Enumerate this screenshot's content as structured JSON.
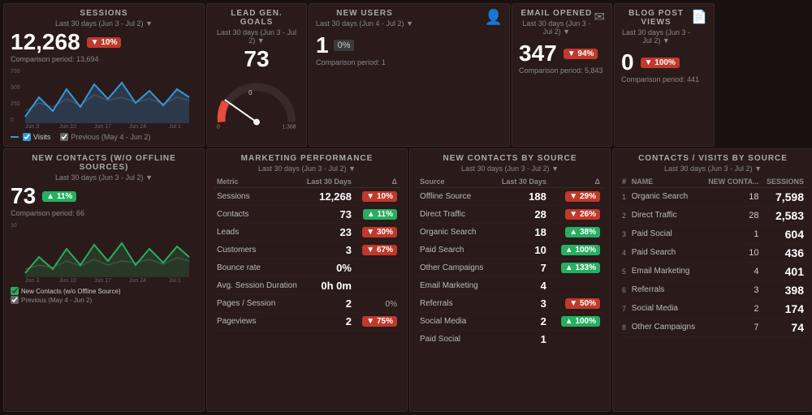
{
  "colors": {
    "red_badge": "#c0392b",
    "green_badge": "#27ae60",
    "bg_panel": "#2a1a1a",
    "blue_line": "#3498db",
    "gray_line": "#7f8c8d",
    "accent_red": "#e74c3c"
  },
  "sessions": {
    "title": "SESSIONS",
    "subtitle": "Last 30 days (Jun 3 - Jul 2)",
    "value": "12,268",
    "badge": "▼ 10%",
    "badge_type": "red",
    "comparison": "Comparison period: 13,694",
    "x_labels": [
      "Jun 3",
      "Jun 10",
      "Jun 17",
      "Jun 24",
      "Jul 1"
    ],
    "y_labels": [
      "750",
      "500",
      "250",
      "0"
    ],
    "legend_visits": "Visits",
    "legend_previous": "Previous (May 4 - Jun 2)"
  },
  "new_contacts": {
    "title": "NEW CONTACTS (W/O OFFLINE SOURCES)",
    "subtitle": "Last 30 days (Jun 3 - Jul 2)",
    "value": "73",
    "badge": "▲ 11%",
    "badge_type": "green",
    "comparison": "Comparison period: 66",
    "legend_contacts": "New Contacts (w/o Offline Source)",
    "legend_previous": "Previous (May 4 - Jun 2)"
  },
  "lead_gen": {
    "title": "LEAD GEN. GOALS",
    "subtitle": "Last 30 days (Jun 3 - Jul 2)",
    "value": "73",
    "gauge_max": "1,368",
    "gauge_min": "0",
    "gauge_label": "0"
  },
  "new_users": {
    "title": "NEW USERS",
    "subtitle": "Last 30 days (Jun 4 - Jul 2)",
    "icon": "person",
    "value": "1",
    "badge": "0%",
    "badge_type": "neutral",
    "comparison": "Comparison period: 1"
  },
  "email_opened": {
    "title": "EMAIL OPENED",
    "subtitle": "Last 30 days (Jun 3 - Jul 2)",
    "icon": "email",
    "value": "347",
    "badge": "▼ 94%",
    "badge_type": "red",
    "comparison": "Comparison period: 5,843"
  },
  "blog_post_views": {
    "title": "BLOG POST VIEWS",
    "subtitle": "Last 30 days (Jun 3 - Jul 2)",
    "icon": "blog",
    "value": "0",
    "badge": "▼ 100%",
    "badge_type": "red",
    "comparison": "Comparison period: 441"
  },
  "marketing_performance": {
    "title": "MARKETING PERFORMANCE",
    "subtitle": "Last 30 days (Jun 3 - Jul 2)",
    "columns": [
      "Metric",
      "Last 30 Days",
      "Δ"
    ],
    "rows": [
      {
        "metric": "Sessions",
        "value": "12,268",
        "badge": "▼ 10%",
        "badge_type": "red"
      },
      {
        "metric": "Contacts",
        "value": "73",
        "badge": "▲ 11%",
        "badge_type": "green"
      },
      {
        "metric": "Leads",
        "value": "23",
        "badge": "▼ 30%",
        "badge_type": "red"
      },
      {
        "metric": "Customers",
        "value": "3",
        "badge": "▼ 67%",
        "badge_type": "red"
      },
      {
        "metric": "Bounce rate",
        "value": "0%",
        "badge": "",
        "badge_type": "none"
      },
      {
        "metric": "Avg. Session Duration",
        "value": "0h 0m",
        "badge": "",
        "badge_type": "none"
      },
      {
        "metric": "Pages / Session",
        "value": "2",
        "badge": "0%",
        "badge_type": "neutral"
      },
      {
        "metric": "Pageviews",
        "value": "2",
        "badge": "▼ 75%",
        "badge_type": "red"
      }
    ]
  },
  "new_contacts_by_source": {
    "title": "NEW CONTACTS BY SOURCE",
    "subtitle": "Last 30 days (Jun 3 - Jul 2)",
    "columns": [
      "Source",
      "Last 30 Days",
      "Δ"
    ],
    "rows": [
      {
        "source": "Offline Source",
        "value": "188",
        "badge": "▼ 29%",
        "badge_type": "red"
      },
      {
        "source": "Direct Traffic",
        "value": "28",
        "badge": "▼ 26%",
        "badge_type": "red"
      },
      {
        "source": "Organic Search",
        "value": "18",
        "badge": "▲ 38%",
        "badge_type": "green"
      },
      {
        "source": "Paid Search",
        "value": "10",
        "badge": "▲ 100%",
        "badge_type": "green"
      },
      {
        "source": "Other Campaigns",
        "value": "7",
        "badge": "▲ 133%",
        "badge_type": "green"
      },
      {
        "source": "Email Marketing",
        "value": "4",
        "badge": "",
        "badge_type": "none"
      },
      {
        "source": "Referrals",
        "value": "3",
        "badge": "▼ 50%",
        "badge_type": "red"
      },
      {
        "source": "Social Media",
        "value": "2",
        "badge": "▲ 100%",
        "badge_type": "green"
      },
      {
        "source": "Paid Social",
        "value": "1",
        "badge": "",
        "badge_type": "none"
      }
    ]
  },
  "contacts_visits_by_source": {
    "title": "CONTACTS / VISITS BY SOURCE",
    "subtitle": "Last 30 days (Jun 3 - Jul 2)",
    "columns": [
      "#",
      "NAME",
      "NEW CONTA...",
      "SESSIONS"
    ],
    "rows": [
      {
        "num": "1",
        "name": "Organic Search",
        "contacts": "18",
        "sessions": "7,598"
      },
      {
        "num": "2",
        "name": "Direct Traffic",
        "contacts": "28",
        "sessions": "2,583"
      },
      {
        "num": "3",
        "name": "Paid Social",
        "contacts": "1",
        "sessions": "604"
      },
      {
        "num": "4",
        "name": "Paid Search",
        "contacts": "10",
        "sessions": "436"
      },
      {
        "num": "5",
        "name": "Email Marketing",
        "contacts": "4",
        "sessions": "401"
      },
      {
        "num": "6",
        "name": "Referrals",
        "contacts": "3",
        "sessions": "398"
      },
      {
        "num": "7",
        "name": "Social Media",
        "contacts": "2",
        "sessions": "174"
      },
      {
        "num": "8",
        "name": "Other Campaigns",
        "contacts": "7",
        "sessions": "74"
      }
    ]
  }
}
